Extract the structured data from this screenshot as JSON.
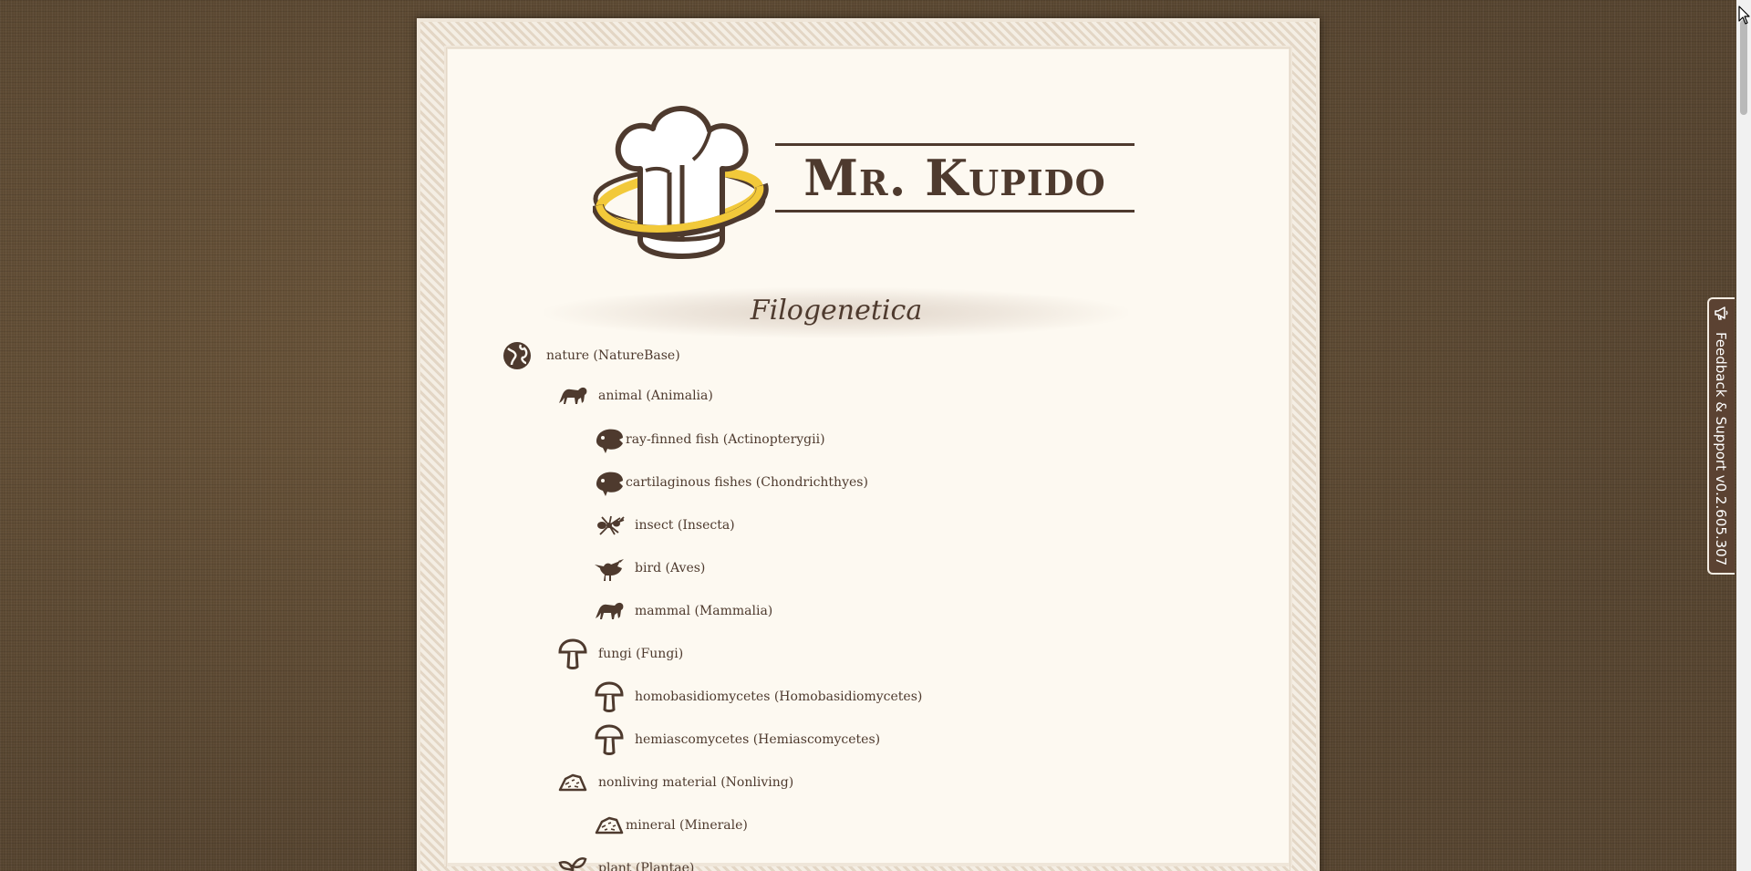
{
  "brand": {
    "name": "Mr. Kupido"
  },
  "section": {
    "title": "Filogenetica"
  },
  "tree": [
    {
      "label": "nature (NatureBase)",
      "icon": "globe-icon"
    },
    {
      "label": "animal (Animalia)",
      "icon": "lion-icon"
    },
    {
      "label": "ray-finned fish (Actinopterygii)",
      "icon": "fish-icon"
    },
    {
      "label": "cartilaginous fishes (Chondrichthyes)",
      "icon": "fish-icon"
    },
    {
      "label": "insect (Insecta)",
      "icon": "ant-icon"
    },
    {
      "label": "bird (Aves)",
      "icon": "bird-icon"
    },
    {
      "label": "mammal (Mammalia)",
      "icon": "lion-icon"
    },
    {
      "label": "fungi (Fungi)",
      "icon": "mushroom-icon"
    },
    {
      "label": "homobasidiomycetes (Homobasidiomycetes)",
      "icon": "mushroom-icon"
    },
    {
      "label": "hemiascomycetes (Hemiascomycetes)",
      "icon": "mushroom-icon"
    },
    {
      "label": "nonliving material (Nonliving)",
      "icon": "mineral-icon"
    },
    {
      "label": "mineral (Minerale)",
      "icon": "mineral-icon"
    },
    {
      "label": "plant (Plantae)",
      "icon": "plant-icon"
    }
  ],
  "feedback": {
    "label": "Feedback & Support v0.2.605.307",
    "icon": "megaphone-icon"
  },
  "colors": {
    "primary_brown": "#4e3a2e",
    "accent_yellow": "#f2c93a",
    "page_bg": "#fdf9f1"
  }
}
